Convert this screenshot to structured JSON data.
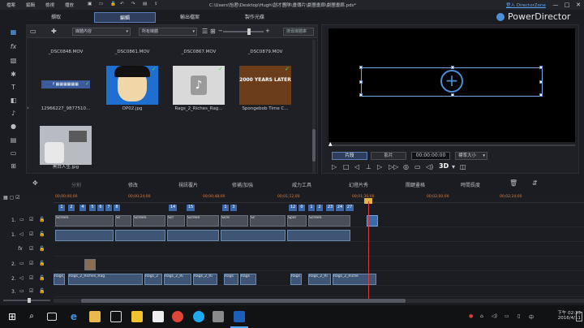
{
  "titlebar": {
    "menus": [
      "檔案",
      "編輯",
      "檢視",
      "播放"
    ],
    "path": "C:\\Users\\怡君\\Desktop\\Hugh\\創才團隊\\畫傳片\\劇團畫廊\\劇團畫廊.pds*",
    "login": "登入 DirectorZone",
    "minimize": "—",
    "maximize": "□",
    "close": "✕"
  },
  "modes": [
    "擷取",
    "編輯",
    "輸出檔案",
    "製作光碟"
  ],
  "active_mode": "編輯",
  "brand": "PowerDirector",
  "library": {
    "filter_type": "媒體內容",
    "filter_all": "所有媒體",
    "search_placeholder": "搜尋媒體庫",
    "items": [
      {
        "label": "_DSC0848.MOV",
        "checked": false
      },
      {
        "label": "_DSC0861.MOV",
        "checked": false
      },
      {
        "label": "_DSC0867.MOV",
        "checked": false
      },
      {
        "label": "_DSC0879.MOV",
        "checked": false
      },
      {
        "label": "12966227_9877510...",
        "checked": true
      },
      {
        "label": "OP02.jpg",
        "checked": true
      },
      {
        "label": "Rags_2_Riches_Rag...",
        "checked": true
      },
      {
        "label": "Spongebob Time C...",
        "checked": true
      },
      {
        "label": "黑白人生.jpg",
        "checked": false
      }
    ],
    "spongebob_text": "2000 YEARS LATER"
  },
  "preview": {
    "mode_clip": "片段",
    "mode_movie": "影片",
    "timecode": "00:00:00:00",
    "fit": "標準大小",
    "three_d": "3D"
  },
  "edit_tools": [
    "分割",
    "修改",
    "視訊覆片",
    "修補/加強",
    "威力工具",
    "幻燈片秀",
    "關鍵畫格",
    "時間長度"
  ],
  "timeline": {
    "ticks": [
      "00;00;00;00",
      "00;00;24;00",
      "00;00;48;00",
      "00;01;12;00",
      "00;01;36;00",
      "00;02;00;00",
      "00;02;24;00",
      "00;02;48;00"
    ],
    "tracks": [
      {
        "label": "1."
      },
      {
        "label": "1."
      },
      {
        "label": "fx"
      },
      {
        "label": "2."
      },
      {
        "label": "2."
      },
      {
        "label": "3."
      },
      {
        "label": "3."
      }
    ],
    "video_clip_labels": [
      "Screen",
      "Screen",
      "Sc",
      "Screen",
      "Scr",
      "Scre",
      "Sc",
      "Spor",
      "Screen"
    ],
    "audio_clip_labels": [
      "Rags_2_Riches_Rag",
      "Rags_2",
      "Rags_2_Ri",
      "Rags_2_Ri",
      "Rags",
      "Rags_2",
      "Rags",
      "Rags_2_Ri",
      "Rags_2_Riche",
      "Rags_2"
    ],
    "markers": [
      "1",
      "2",
      "4",
      "5",
      "6",
      "7",
      "8",
      "14",
      "15",
      "1",
      "3",
      "12",
      "0",
      "1",
      "2",
      "23",
      "24",
      "27"
    ]
  },
  "taskbar": {
    "time": "下午 02:33",
    "date": "2016/4/11",
    "lang": "中"
  }
}
